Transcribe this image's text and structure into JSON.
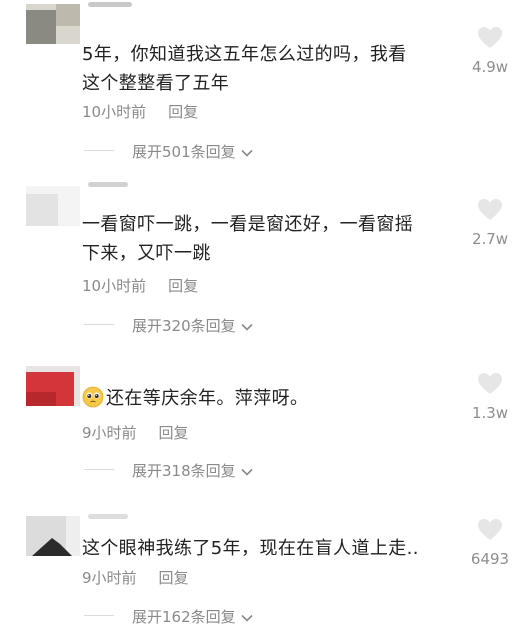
{
  "comments": [
    {
      "text_lines": [
        "5年，你知道我这五年怎么过的吗，我看",
        "这个整整看了五年"
      ],
      "time": "10小时前",
      "reply": "回复",
      "expand": "展开501条回复",
      "likes": "4.9w",
      "avatar_colors": [
        "#8b8a80",
        "#bdb9ad",
        "#d9d6cd"
      ]
    },
    {
      "text_lines": [
        "一看窗吓一跳，一看是窗还好，一看窗摇",
        "下来，又吓一跳"
      ],
      "time": "10小时前",
      "reply": "回复",
      "expand": "展开320条回复",
      "likes": "2.7w",
      "avatar_colors": [
        "#e3e3e3",
        "#efefef",
        "#f4f4f4"
      ]
    },
    {
      "text_lines": [
        "还在等庆余年。萍萍呀。"
      ],
      "emoji": "pleading-face",
      "time": "9小时前",
      "reply": "回复",
      "expand": "展开318条回复",
      "likes": "1.3w",
      "avatar_colors": [
        "#d4353a",
        "#b7282d",
        "#e9e3e3"
      ]
    },
    {
      "text_lines": [
        "这个眼神我练了5年，现在在盲人道上走.."
      ],
      "time": "9小时前",
      "reply": "回复",
      "expand": "展开162条回复",
      "likes": "6493",
      "avatar_colors": [
        "#dcdcdc",
        "#2b2b2b",
        "#eeeeee"
      ]
    }
  ],
  "icons": {
    "like": "heart-icon",
    "expand": "chevron-down-icon"
  },
  "colors": {
    "text": "#222222",
    "meta": "#8a8a8a",
    "divider": "#dcdcdc"
  }
}
